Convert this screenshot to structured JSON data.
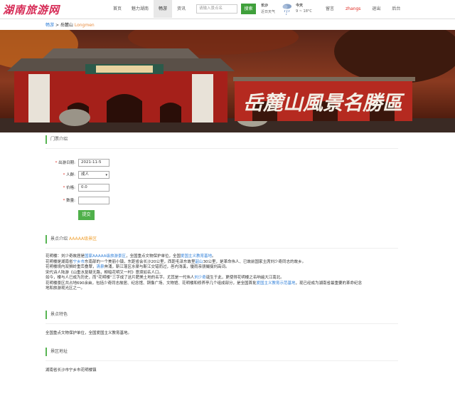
{
  "header": {
    "logo": "湖南旅游网",
    "nav": [
      "首页",
      "魅力湖南",
      "畅游",
      "资讯"
    ],
    "search_placeholder": "请输入景点名",
    "search_button": "搜索",
    "weather": {
      "city": "长沙",
      "sub": "近日天气",
      "day": "今天",
      "temp": "9 ~ 18°C"
    },
    "right_nav": [
      "留言",
      "zhangs",
      "退出",
      "后台"
    ]
  },
  "breadcrumb": {
    "home": "畅游",
    "sep": ">",
    "current": "岳麓山",
    "en": "Longmen"
  },
  "banner": {
    "calligraphy": "岳麓山風景名勝區"
  },
  "sections": {
    "intro_title": "门票介绍",
    "spot_title": "景点介绍",
    "spot_level": "AAAAA级景区",
    "feature_title": "景点特色",
    "address_title": "景区地址"
  },
  "form": {
    "date_label": "出游日期:",
    "date_value": "2021-11-5",
    "people_label": "人群:",
    "people_value": "成人",
    "price_label": "价格:",
    "price_value": "0.0",
    "qty_label": "数量:",
    "qty_value": "",
    "submit": "提交"
  },
  "intro": {
    "line1a": "花明楼：刘少奇故居是",
    "line1b": "国家AAAAA级旅游景区",
    "line1c": "，全国重点文物保护单位，全国",
    "line1d": "爱国主义教育基地",
    "line1e": "。",
    "line2a": "花明楼是湖南省",
    "line2b": "宁乡市",
    "line2c": "东南部的一个美丽小镇，东距省会长沙20公里，西距毛泽东故里",
    "line2d": "韶山",
    "line2e": "30公里，是革命伟人、已故前国家主席刘少奇同志的故乡。",
    "line3a": "花明楼境内双狮岭重峦叠翠，",
    "line3b": "清泉",
    "line3c": "奔涌，靳江蓬区水渠与靳江交错而过，邑内浅溪，優雨亲朋撮掇刘高词。",
    "line4": "宋代诗人陆游《山重水复疑无路，柳暗花明又一村》意境如名人口。",
    "line5a": "如今，楼与人已成为历史，而“花明楼”三字成了这片肥美土地的名字。尤其是一代伟人",
    "line5b": "刘少奇",
    "line5c": "诞生于此，更使得花明楼之名响遍大江南北。",
    "line6a": "花明楼景区共占地690余亩，包括少奇同志故居、纪念馆、铜像广场、文物馆、花明楼和修养亭几个组成部分，是全国首批",
    "line6b": "爱国主义教育示范基地",
    "line6c": "，现已经成为湖南省最重要的革命纪念",
    "line7": "地和旅游观光区之一。"
  },
  "feature_text": "全国重点文物保护单位，全国爱国主义教育基地。",
  "address_text": "湖南省长沙市宁乡市花明楼镇"
}
